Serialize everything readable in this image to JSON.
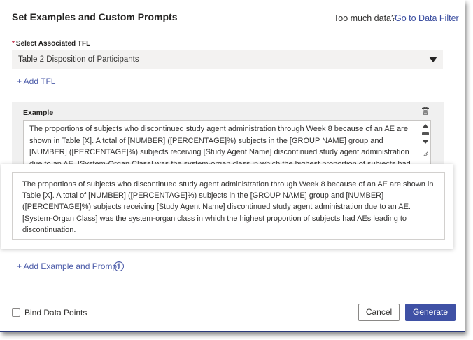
{
  "header": {
    "title": "Set Examples and Custom Prompts",
    "too_much_data": "Too much data?",
    "data_filter_link": "Go to Data Filter"
  },
  "tfl": {
    "label": "Select Associated TFL",
    "selected": "Table 2 Disposition of Participants",
    "add_label": "+ Add TFL"
  },
  "example": {
    "label": "Example",
    "text": "The proportions of subjects who discontinued study agent administration through Week 8 because of an AE are shown in Table [X]. A total of [NUMBER] ([PERCENTAGE]%) subjects in the [GROUP NAME] group and [NUMBER] ([PERCENTAGE]%) subjects receiving [Study Agent Name] discontinued study agent administration due to an AE. [System-Organ Class] was the system-organ class in which the highest proportion of subjects had AEs leading to discontinuation."
  },
  "tooltip": {
    "text": "The proportions of subjects who discontinued study agent administration through Week 8 because of an AE are shown in Table [X]. A total of [NUMBER] ([PERCENTAGE]%) subjects in the [GROUP NAME] group and [NUMBER] ([PERCENTAGE]%) subjects receiving [Study Agent Name] discontinued study agent administration due to an AE. [System-Organ Class] was the system-organ class in which the highest proportion of subjects had AEs leading to discontinuation."
  },
  "add_example_label": "+ Add Example and Prompt",
  "info_glyph": "i",
  "footer": {
    "bind_label": "Bind Data Points",
    "cancel_label": "Cancel",
    "generate_label": "Generate"
  },
  "colors": {
    "accent": "#3f51a5",
    "link": "#4a5aa8",
    "required": "#c4314b"
  }
}
